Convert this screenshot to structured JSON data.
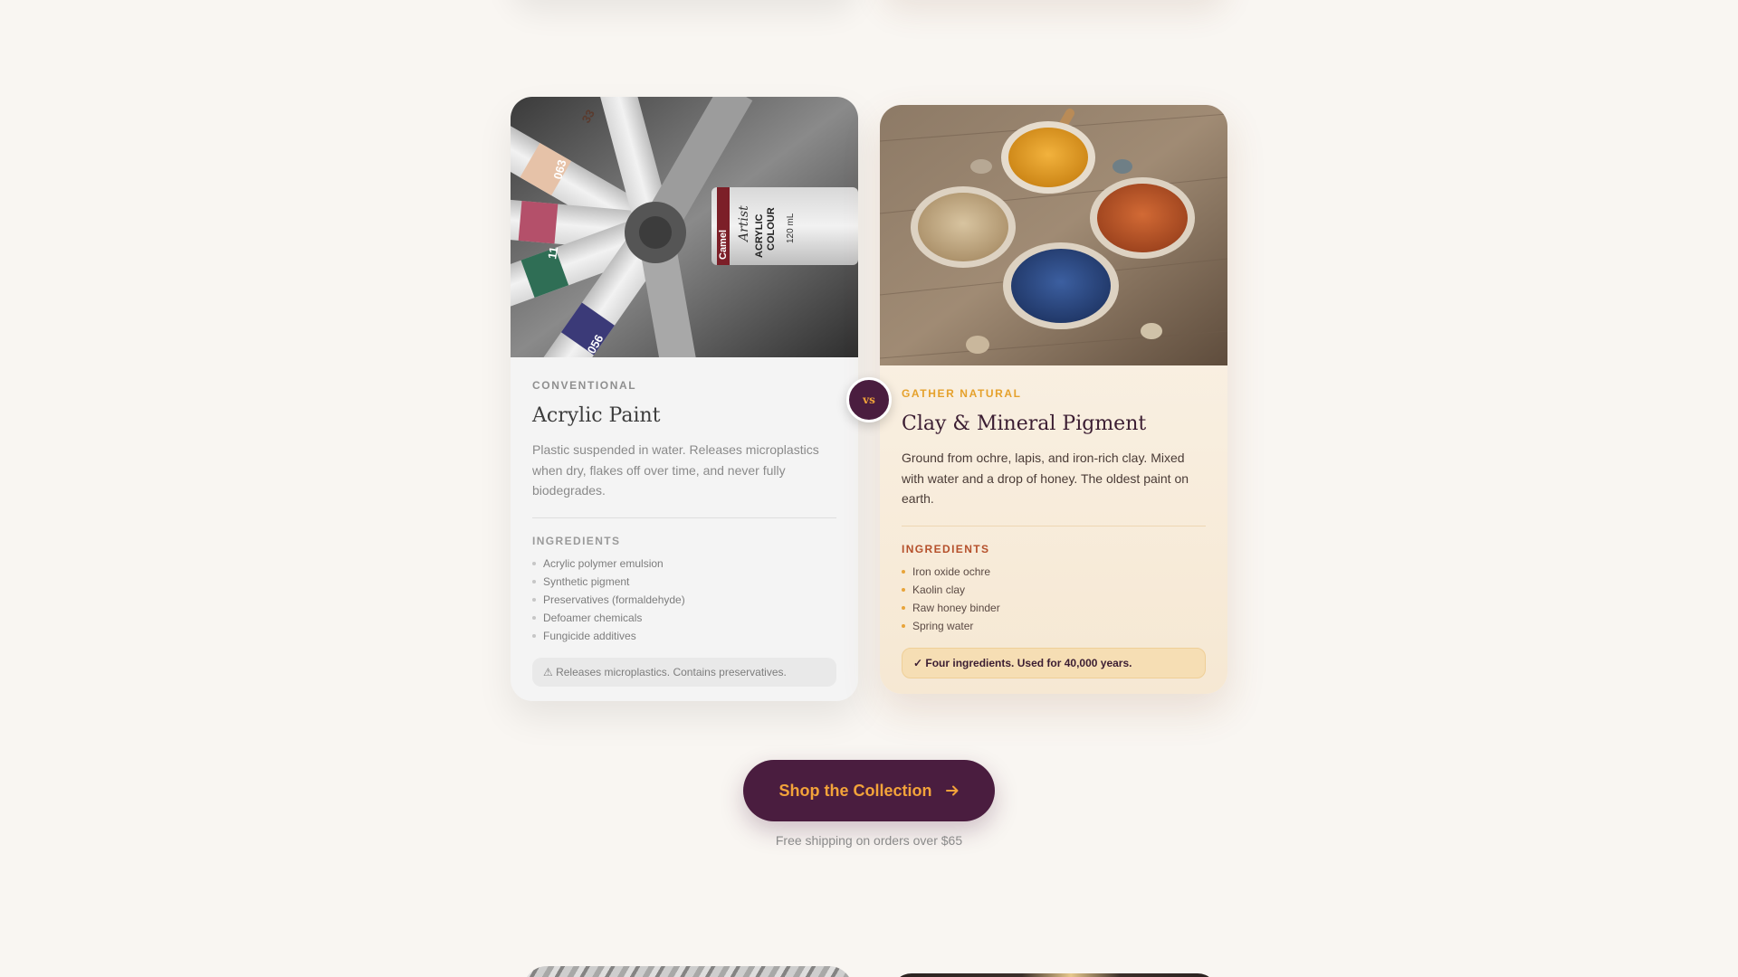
{
  "conventional": {
    "eyebrow": "CONVENTIONAL",
    "title": "Acrylic Paint",
    "description": "Plastic suspended in water. Releases microplastics when dry, flakes off over time, and never fully biodegrades.",
    "image_alt": "Acrylic paint tubes",
    "image_text": {
      "brand": "Camel",
      "script": "Artist",
      "label_line1": "ACRYLIC",
      "label_line2": "COLOUR",
      "volume": "120 mL",
      "tube_codes": [
        "063",
        "11",
        "056",
        "33"
      ]
    },
    "ingredients_title": "INGREDIENTS",
    "ingredients": [
      "Acrylic polymer emulsion",
      "Synthetic pigment",
      "Preservatives (formaldehyde)",
      "Defoamer chemicals",
      "Fungicide additives"
    ],
    "note": "⚠ Releases microplastics. Contains preservatives."
  },
  "natural": {
    "eyebrow": "GATHER NATURAL",
    "title": "Clay & Mineral Pigment",
    "description": "Ground from ochre, lapis, and iron-rich clay. Mixed with water and a drop of honey. The oldest paint on earth.",
    "image_alt": "Bowls of natural mineral pigments",
    "ingredients_title": "INGREDIENTS",
    "ingredients": [
      "Iron oxide ochre",
      "Kaolin clay",
      "Raw honey binder",
      "Spring water"
    ],
    "note": "✓ Four ingredients. Used for 40,000 years."
  },
  "vs_label": "vs",
  "cta": {
    "label": "Shop the Collection",
    "icon": "arrow-right-icon"
  },
  "shipping_text": "Free shipping on orders over $65",
  "colors": {
    "plum": "#4a1d3f",
    "amber": "#f3a33a",
    "rust": "#b5502b",
    "background": "#f9f6f2"
  }
}
